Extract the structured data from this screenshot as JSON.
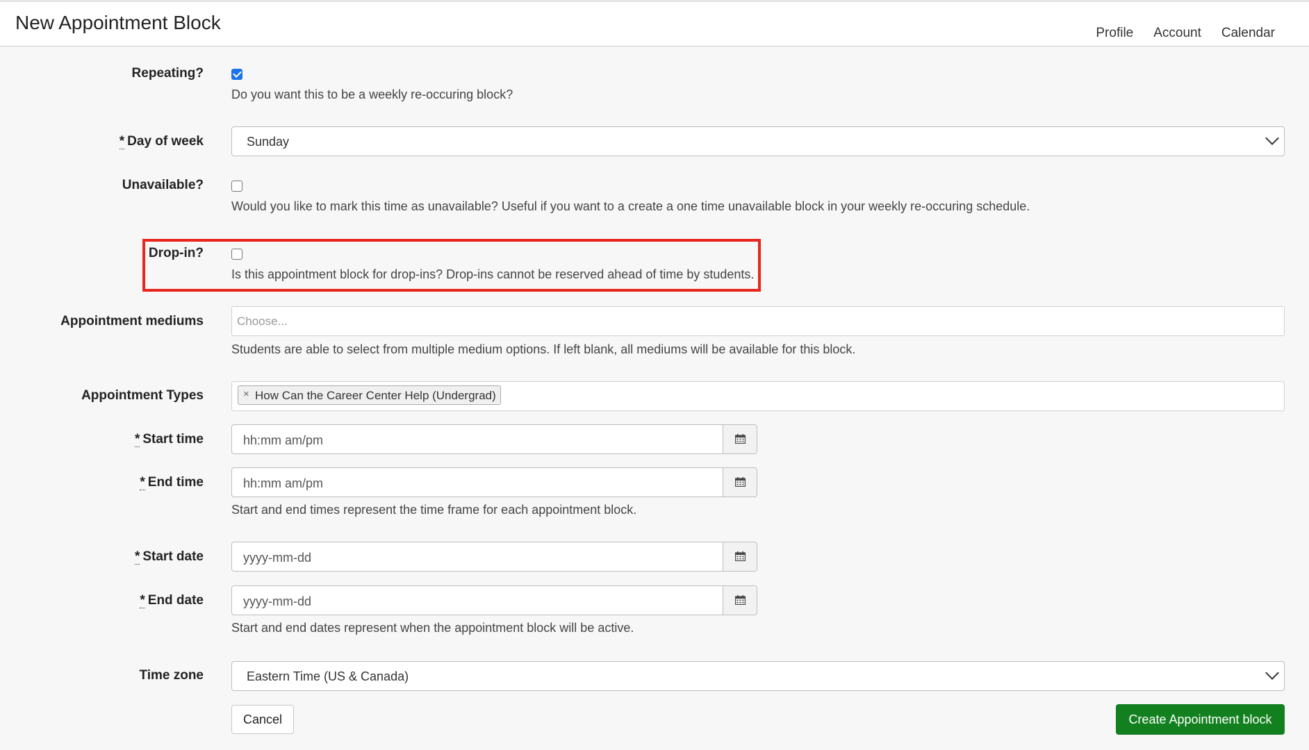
{
  "header": {
    "title": "New Appointment Block",
    "nav": [
      "Profile",
      "Account",
      "Calendar"
    ]
  },
  "form": {
    "repeating": {
      "label": "Repeating?",
      "checked": true,
      "help": "Do you want this to be a weekly re-occuring block?"
    },
    "day_of_week": {
      "required_mark": "*",
      "label": "Day of week",
      "value": "Sunday"
    },
    "unavailable": {
      "label": "Unavailable?",
      "checked": false,
      "help": "Would you like to mark this time as unavailable? Useful if you want to a create a one time unavailable block in your weekly re-occuring schedule."
    },
    "drop_in": {
      "label": "Drop-in?",
      "checked": false,
      "help": "Is this appointment block for drop-ins? Drop-ins cannot be reserved ahead of time by students."
    },
    "mediums": {
      "label": "Appointment mediums",
      "placeholder": "Choose...",
      "help": "Students are able to select from multiple medium options. If left blank, all mediums will be available for this block."
    },
    "types": {
      "label": "Appointment Types",
      "tags": [
        "How Can the Career Center Help (Undergrad)"
      ],
      "remove_glyph": "×"
    },
    "start_time": {
      "required_mark": "*",
      "label": "Start time",
      "placeholder": "hh:mm am/pm"
    },
    "end_time": {
      "required_mark": "*",
      "label": "End time",
      "placeholder": "hh:mm am/pm",
      "help": "Start and end times represent the time frame for each appointment block."
    },
    "start_date": {
      "required_mark": "*",
      "label": "Start date",
      "placeholder": "yyyy-mm-dd"
    },
    "end_date": {
      "required_mark": "*",
      "label": "End date",
      "placeholder": "yyyy-mm-dd",
      "help": "Start and end dates represent when the appointment block will be active."
    },
    "time_zone": {
      "label": "Time zone",
      "value": "Eastern Time (US & Canada)"
    }
  },
  "buttons": {
    "cancel": "Cancel",
    "create": "Create Appointment block"
  },
  "colors": {
    "primary_button": "#12801e",
    "highlight_border": "#e8261c",
    "checkbox_checked": "#1a73e8"
  },
  "icons": {
    "calendar": "calendar-icon",
    "dropdown": "chevron-down-icon",
    "remove": "close-icon"
  }
}
